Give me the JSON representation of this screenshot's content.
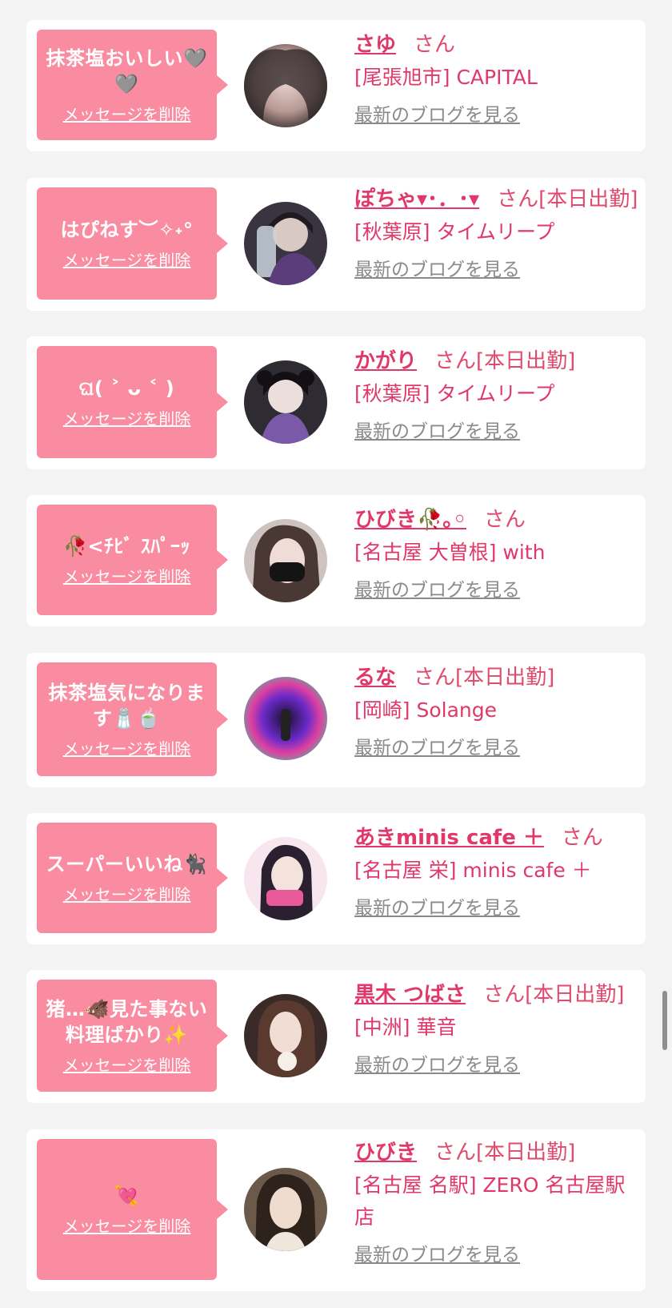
{
  "items": [
    {
      "message": "抹茶塩おいしい🩶🩶",
      "delete_label": "メッセージを削除",
      "name": "さゆ",
      "honorific": "さん",
      "status": "",
      "shop": "[尾張旭市] CAPITAL",
      "blog_link": "最新のブログを見る"
    },
    {
      "message": "はぴねす︶✧˖°",
      "delete_label": "メッセージを削除",
      "name": "ぽちゃ▾･．･▾",
      "honorific": "さん",
      "status": "[本日出勤]",
      "shop": "[秋葉原] タイムリープ",
      "blog_link": "最新のブログを見る"
    },
    {
      "message": "ଘ( ˃ ᴗ ˂ )",
      "delete_label": "メッセージを削除",
      "name": "かがり",
      "honorific": "さん",
      "status": "[本日出勤]",
      "shop": "[秋葉原] タイムリープ",
      "blog_link": "最新のブログを見る"
    },
    {
      "message": "🥀<ﾁﾋﾞ ｽﾊﾟｰｯ",
      "delete_label": "メッセージを削除",
      "name": "ひびき🥀｡◦",
      "honorific": "さん",
      "status": "",
      "shop": "[名古屋 大曽根] with",
      "blog_link": "最新のブログを見る"
    },
    {
      "message": "抹茶塩気になります🧂🍵",
      "delete_label": "メッセージを削除",
      "name": "るな",
      "honorific": "さん",
      "status": "[本日出勤]",
      "shop": "[岡崎] Solange",
      "blog_link": "最新のブログを見る"
    },
    {
      "message": "スーパーいいね🐈‍⬛",
      "delete_label": "メッセージを削除",
      "name": "あきminis cafe ＋",
      "honorific": "さん",
      "status": "",
      "shop": "[名古屋 栄] minis cafe ＋",
      "blog_link": "最新のブログを見る"
    },
    {
      "message": "猪…🐗見た事ない料理ばかり✨",
      "delete_label": "メッセージを削除",
      "name": "黒木 つばさ",
      "honorific": "さん",
      "status": "[本日出勤]",
      "shop": "[中洲] 華音",
      "blog_link": "最新のブログを見る"
    },
    {
      "message": "💘",
      "delete_label": "メッセージを削除",
      "name": "ひびき",
      "honorific": "さん",
      "status": "[本日出勤]",
      "shop": "[名古屋 名駅] ZERO 名古屋駅店",
      "blog_link": "最新のブログを見る"
    }
  ],
  "colors": {
    "bubble": "#f98ca0",
    "name": "#e0386a",
    "link": "#8a8a8a",
    "page_bg": "#f3f3f3"
  }
}
